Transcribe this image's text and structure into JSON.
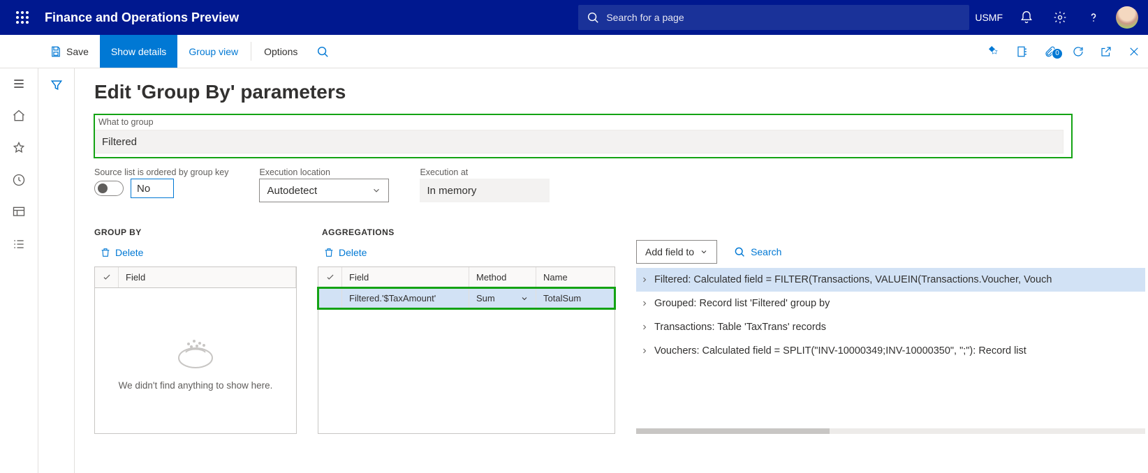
{
  "app_title": "Finance and Operations Preview",
  "search_placeholder": "Search for a page",
  "company": "USMF",
  "actionpane": {
    "save": "Save",
    "show_details": "Show details",
    "group_view": "Group view",
    "options": "Options",
    "attach_count": "0"
  },
  "page": {
    "title": "Edit 'Group By' parameters",
    "what_to_group_label": "What to group",
    "what_to_group_value": "Filtered",
    "source_ordered_label": "Source list is ordered by group key",
    "source_ordered_value": "No",
    "exec_location_label": "Execution location",
    "exec_location_value": "Autodetect",
    "exec_at_label": "Execution at",
    "exec_at_value": "In memory"
  },
  "sections": {
    "group_by": "GROUP BY",
    "aggregations": "AGGREGATIONS",
    "delete": "Delete",
    "add_field_to": "Add field to",
    "search": "Search"
  },
  "groupby_grid": {
    "field_header": "Field",
    "empty_text": "We didn't find anything to show here."
  },
  "agg_grid": {
    "field_header": "Field",
    "method_header": "Method",
    "name_header": "Name",
    "row": {
      "field": "Filtered.'$TaxAmount'",
      "method": "Sum",
      "name": "TotalSum"
    }
  },
  "tree": [
    "Filtered: Calculated field = FILTER(Transactions, VALUEIN(Transactions.Voucher, Vouch",
    "Grouped: Record list 'Filtered' group by",
    "Transactions: Table 'TaxTrans' records",
    "Vouchers: Calculated field = SPLIT(\"INV-10000349;INV-10000350\", \";\"): Record list"
  ]
}
